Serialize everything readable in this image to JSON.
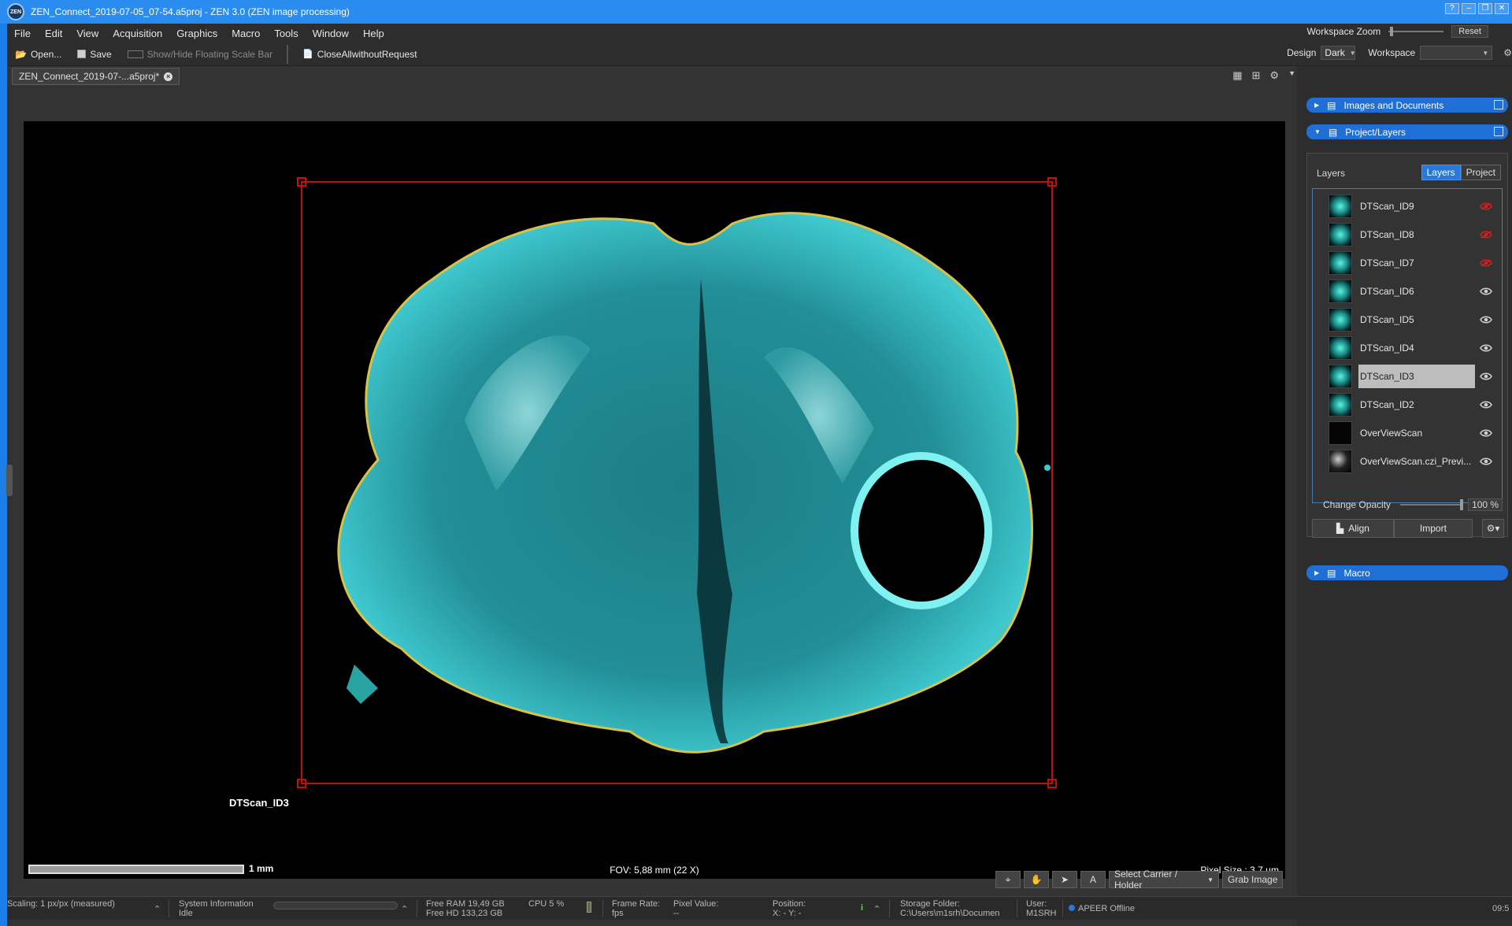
{
  "window": {
    "title": "ZEN_Connect_2019-07-05_07-54.a5proj - ZEN 3.0 (ZEN image processing)",
    "logo_text": "ZEN"
  },
  "menu": {
    "items": [
      "File",
      "Edit",
      "View",
      "Acquisition",
      "Graphics",
      "Macro",
      "Tools",
      "Window",
      "Help"
    ],
    "workspace_zoom_label": "Workspace Zoom",
    "reset_label": "Reset"
  },
  "toolbar": {
    "open_label": "Open...",
    "save_label": "Save",
    "scalebar_label": "Show/Hide Floating Scale Bar",
    "macro_label": "CloseAllwithoutRequest",
    "design_label": "Design",
    "design_value": "Dark",
    "workspace_label": "Workspace",
    "workspace_value": ""
  },
  "document": {
    "tab_label": "ZEN_Connect_2019-07-...a5proj*",
    "image_label": "DTScan_ID3",
    "scale_text": "1 mm",
    "fov_text": "FOV: 5,88 mm (22 X)",
    "pixel_size_text": "Pixel Size : 3,7 µm",
    "select_carrier_label": "Select Carrier / Holder",
    "grab_image_label": "Grab Image",
    "tool_a_label": "A"
  },
  "panel": {
    "images_docs_label": "Images and Documents",
    "project_layers_label": "Project/Layers",
    "layers_title": "Layers",
    "seg_layers": "Layers",
    "seg_project": "Project",
    "layers": [
      {
        "name": "DTScan_ID9",
        "visible": false,
        "thumb": "tissue"
      },
      {
        "name": "DTScan_ID8",
        "visible": false,
        "thumb": "tissue"
      },
      {
        "name": "DTScan_ID7",
        "visible": false,
        "thumb": "tissue"
      },
      {
        "name": "DTScan_ID6",
        "visible": true,
        "thumb": "tissue"
      },
      {
        "name": "DTScan_ID5",
        "visible": true,
        "thumb": "tissue"
      },
      {
        "name": "DTScan_ID4",
        "visible": true,
        "thumb": "tissue"
      },
      {
        "name": "DTScan_ID3",
        "visible": true,
        "thumb": "tissue",
        "selected": true
      },
      {
        "name": "DTScan_ID2",
        "visible": true,
        "thumb": "tissue"
      },
      {
        "name": "OverViewScan",
        "visible": true,
        "thumb": "dark"
      },
      {
        "name": "OverViewScan.czi_Previ...",
        "visible": true,
        "thumb": "dark2"
      }
    ],
    "change_opacity_label": "Change Opacity",
    "opacity_value": "100 %",
    "align_label": "Align",
    "import_label": "Import",
    "macro_label": "Macro"
  },
  "status": {
    "scaling": "Scaling:   1 px/px (measured)",
    "sysinfo_title": "System Information",
    "sysinfo_value": "Idle",
    "free_ram": "Free RAM  19,49 GB",
    "free_hd": "Free HD     133,23 GB",
    "cpu": "CPU  5 %",
    "frame_rate_title": "Frame Rate:",
    "frame_rate_value": "fps",
    "pixel_value_title": "Pixel Value:",
    "pixel_value_value": "--",
    "position_title": "Position:",
    "position_value": "X: -      Y: -",
    "info_icon_text": "i",
    "storage_title": "Storage Folder:",
    "storage_value": "C:\\Users\\m1srh\\Documen",
    "user_title": "User:",
    "user_value": "M1SRH",
    "apeer": "APEER Offline",
    "time": "09:5"
  },
  "colors": {
    "accent": "#2a8cee",
    "section": "#1f6fd6",
    "roi": "#c01010",
    "tissue_cyan": "#3fc9cf",
    "eye_hidden": "#d02020"
  }
}
